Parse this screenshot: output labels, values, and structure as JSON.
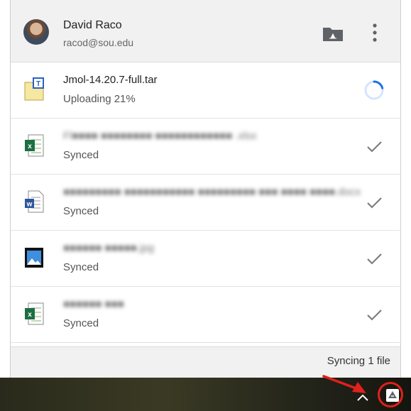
{
  "account": {
    "name": "David Raco",
    "email": "racod@sou.edu"
  },
  "files": [
    {
      "name": "Jmol-14.20.7-full.tar",
      "status": "Uploading 21%",
      "icon": "archive-file-icon",
      "progress": 0.21,
      "blurred": false
    },
    {
      "name": "Fl■■■■ ■■■■■■■■ ■■■■■■■■■■■■ .xlsx",
      "status": "Synced",
      "icon": "excel-file-icon",
      "blurred": true
    },
    {
      "name": "■■■■■■■■■ ■■■■■■■■■■■ ■■■■■■■■■ ■■■ ■■■■ ■■■■.docx",
      "status": "Synced",
      "icon": "word-file-icon",
      "blurred": true
    },
    {
      "name": "■■■■■■ ■■■■■.jpg",
      "status": "Synced",
      "icon": "image-file-icon",
      "blurred": true
    },
    {
      "name": "■■■■■■ ■■■",
      "status": "Synced",
      "icon": "excel-file-icon",
      "blurred": true
    }
  ],
  "footer": {
    "text": "Syncing 1 file"
  },
  "icons": {
    "drive_folder": "drive-folder-icon",
    "more": "more-vert-icon",
    "tray": "google-drive-tray-icon",
    "chevron": "chevron-up-icon"
  },
  "colors": {
    "progress": "#1a73e8",
    "annotation": "#e0201b"
  }
}
